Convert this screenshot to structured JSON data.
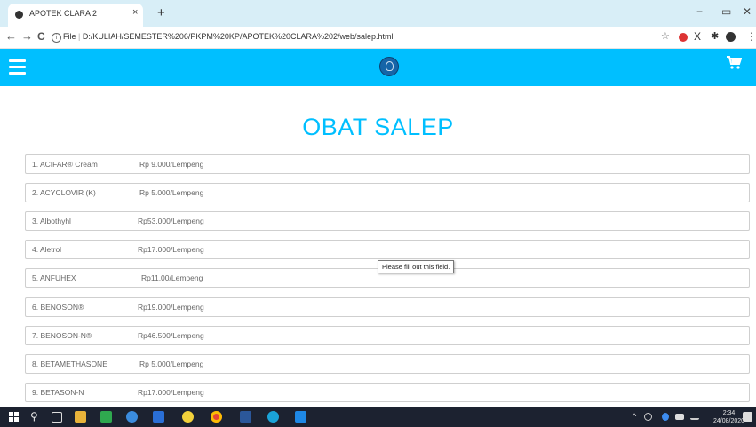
{
  "browser": {
    "tab_title": "APOTEK CLARA 2",
    "tab_close": "×",
    "new_tab": "+",
    "minimize": "−",
    "restore": "▭",
    "close": "✕",
    "back": "←",
    "forward": "→",
    "reload": "C",
    "url_prefix": "File",
    "url": "D:/KULIAH/SEMESTER%206/PKPM%20KP/APOTEK%20CLARA%202/web/salep.html",
    "star": "☆",
    "ext_x": "X",
    "ext_puzzle": "✱",
    "menu_dots": "⋮"
  },
  "header": {
    "background": "#00bfff",
    "menu_icon": "hamburger-icon",
    "logo_icon": "logo-icon",
    "cart_icon": "cart-icon",
    "cart_glyph": "🛒"
  },
  "page": {
    "title": "OBAT SALEP",
    "title_color": "#00bfff"
  },
  "products": [
    {
      "name": "1. ACIFAR® Cream",
      "price": "Rp 9.000/Lempeng"
    },
    {
      "name": "2. ACYCLOVIR (K)",
      "price": "Rp 5.000/Lempeng"
    },
    {
      "name": "3. Albothyhl",
      "price": "Rp53.000/Lempeng"
    },
    {
      "name": "4. Aletrol",
      "price": "Rp17.000/Lempeng"
    },
    {
      "name": "5. ANFUHEX",
      "price": "Rp11.00/Lempeng"
    },
    {
      "name": "6. BENOSON®",
      "price": "Rp19.000/Lempeng"
    },
    {
      "name": "7. BENOSON-N®",
      "price": "Rp46.500/Lempeng"
    },
    {
      "name": "8. BETAMETHASONE",
      "price": "Rp 5.000/Lempeng"
    },
    {
      "name": "9. BETASON-N",
      "price": "Rp17.000/Lempeng"
    }
  ],
  "tooltip": {
    "text": "Please fill out this field."
  },
  "taskbar": {
    "search_glyph": "⚲",
    "tray_arrow": "^",
    "time": "2:34",
    "date": "24/08/2020"
  }
}
